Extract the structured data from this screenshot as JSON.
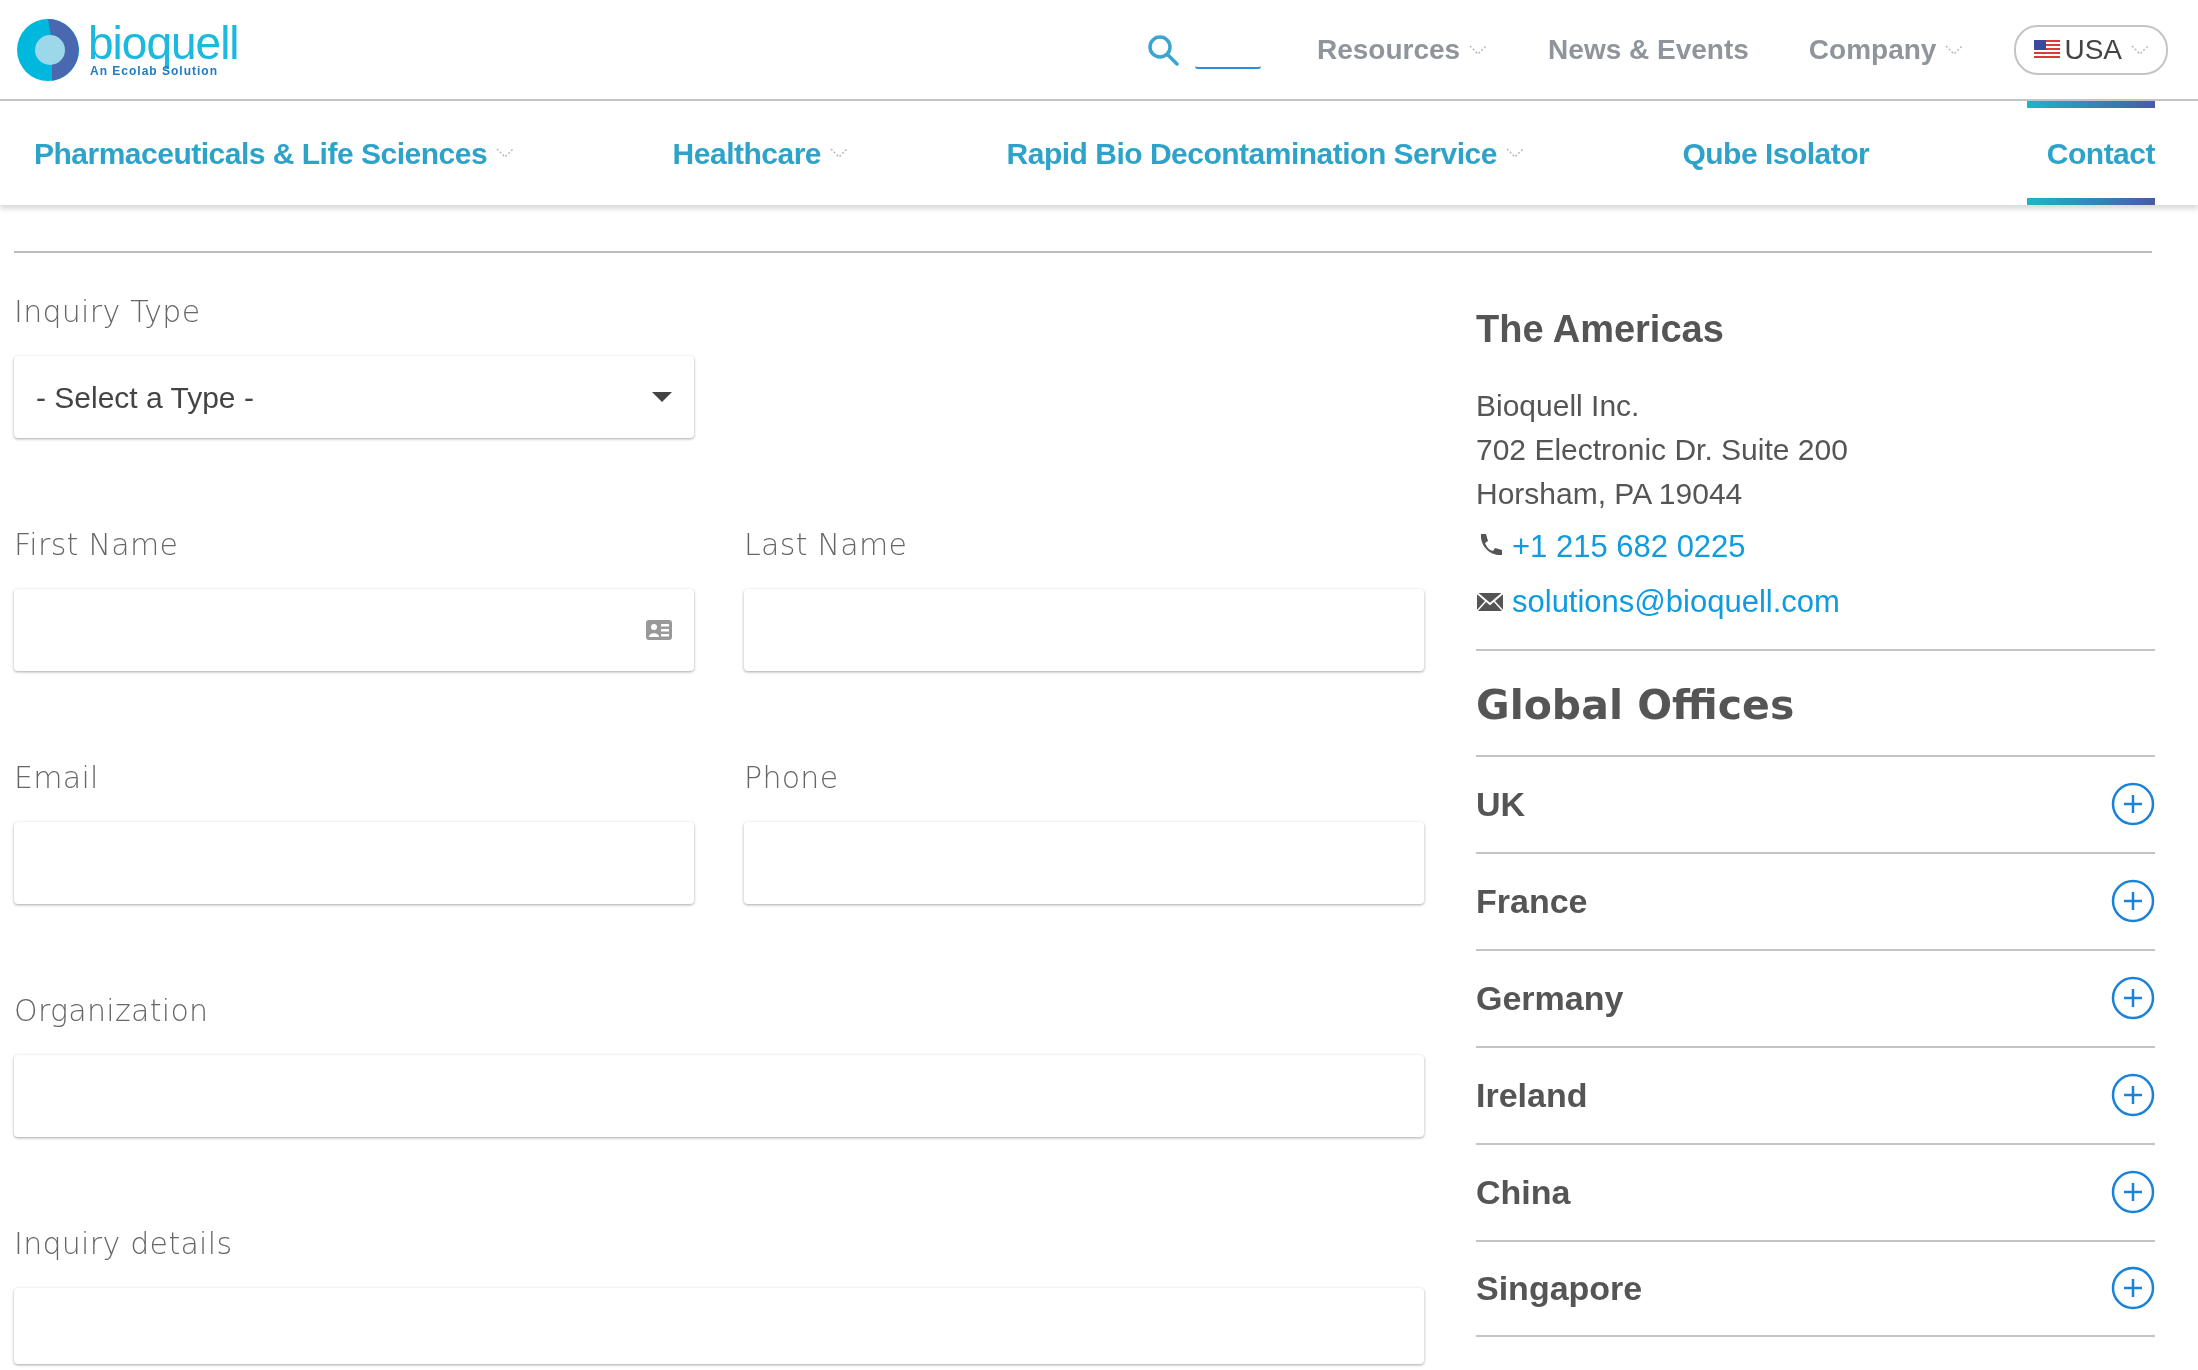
{
  "header": {
    "logo": {
      "wordmark": "bioquell",
      "tagline": "An Ecolab Solution"
    },
    "top_nav": [
      {
        "label": "Resources",
        "has_dropdown": true
      },
      {
        "label": "News & Events",
        "has_dropdown": false
      },
      {
        "label": "Company",
        "has_dropdown": true
      }
    ],
    "country": {
      "label": "USA",
      "has_dropdown": true
    }
  },
  "main_nav": [
    {
      "label": "Pharmaceuticals & Life Sciences",
      "has_dropdown": true,
      "selected": false
    },
    {
      "label": "Healthcare",
      "has_dropdown": true,
      "selected": false
    },
    {
      "label": "Rapid Bio Decontamination Service",
      "has_dropdown": true,
      "selected": false
    },
    {
      "label": "Qube Isolator",
      "has_dropdown": false,
      "selected": false
    },
    {
      "label": "Contact",
      "has_dropdown": false,
      "selected": true
    }
  ],
  "form": {
    "rows": [
      [
        {
          "label": "Inquiry Type",
          "kind": "select",
          "value": "- Select a Type -"
        }
      ],
      [
        {
          "label": "First Name",
          "kind": "text",
          "card_icon": true
        },
        {
          "label": "Last Name",
          "kind": "text",
          "card_icon": false
        }
      ],
      [
        {
          "label": "Email",
          "kind": "text",
          "card_icon": false
        },
        {
          "label": "Phone",
          "kind": "text",
          "card_icon": false
        }
      ],
      [
        {
          "label": "Organization",
          "kind": "text",
          "card_icon": false,
          "full": true
        }
      ],
      [
        {
          "label": "Inquiry details",
          "kind": "textarea",
          "full": true
        }
      ]
    ]
  },
  "americas": {
    "title": "The Americas",
    "address_lines": [
      "Bioquell Inc.",
      "702 Electronic Dr. Suite 200",
      "Horsham, PA 19044"
    ],
    "phone": "+1 215 682 0225",
    "email": "solutions@bioquell.com"
  },
  "global_offices": {
    "title": "Global Offices",
    "items": [
      {
        "name": "UK",
        "expanded": false
      },
      {
        "name": "France",
        "expanded": false
      },
      {
        "name": "Germany",
        "expanded": false
      },
      {
        "name": "Ireland",
        "expanded": false
      },
      {
        "name": "China",
        "expanded": false
      },
      {
        "name": "Singapore",
        "expanded": false
      }
    ]
  }
}
